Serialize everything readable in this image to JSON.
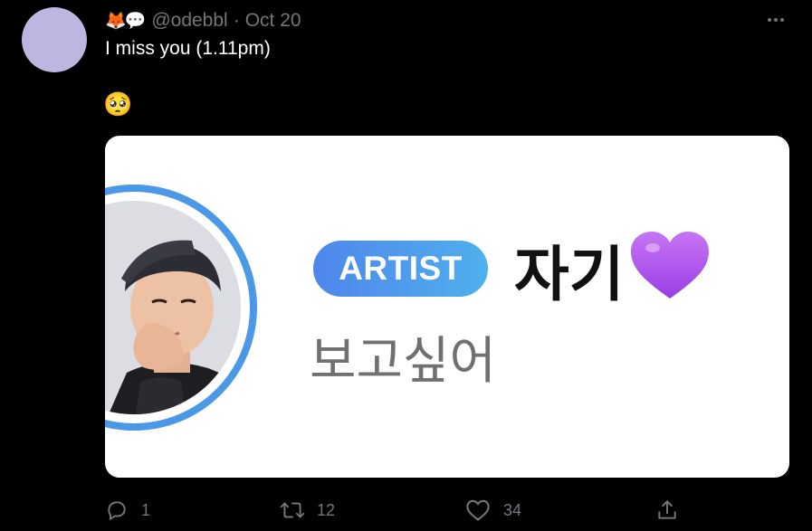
{
  "tweet": {
    "header_emojis": "🦊💬",
    "handle": "@odebbl",
    "separator": "·",
    "date": "Oct 20",
    "text": "I miss you (1.11pm)",
    "emoji_line": "🥺"
  },
  "media": {
    "badge_label": "ARTIST",
    "nickname": "자기",
    "status_message": "보고싶어"
  },
  "actions": {
    "reply_count": "1",
    "retweet_count": "12",
    "like_count": "34"
  },
  "colors": {
    "background": "#000000",
    "secondary_text": "#71767b",
    "avatar": "#bcb7e0",
    "badge_gradient_start": "#4f86ec",
    "badge_gradient_end": "#4fb0ec",
    "ring": "#4a98e6",
    "heart": "#a64ff0"
  }
}
